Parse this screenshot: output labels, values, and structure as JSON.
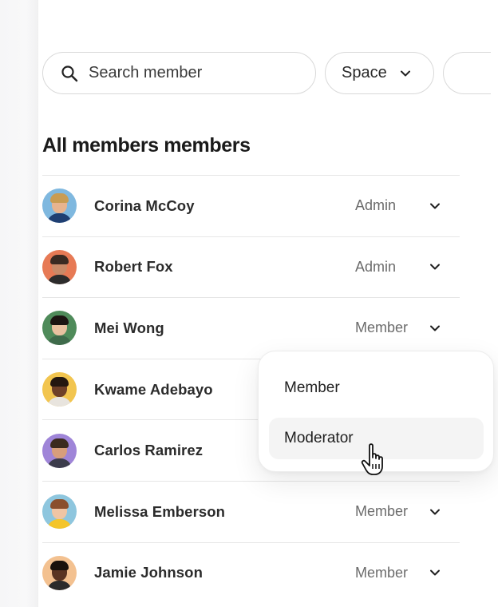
{
  "search": {
    "placeholder": "Search member"
  },
  "filters": {
    "space_label": "Space"
  },
  "title": "All members members",
  "members": [
    {
      "name": "Corina McCoy",
      "role": "Admin",
      "bg": "#7fb8df",
      "skin": "#e8b48f",
      "hair": "#c99c52",
      "shirt": "#1f3f72"
    },
    {
      "name": "Robert Fox",
      "role": "Admin",
      "bg": "#e77a55",
      "skin": "#c98a68",
      "hair": "#3a2a22",
      "shirt": "#2c2c2c"
    },
    {
      "name": "Mei Wong",
      "role": "Member",
      "bg": "#4f8b5a",
      "skin": "#e9c1a0",
      "hair": "#1c1512",
      "shirt": "#3f6b4b"
    },
    {
      "name": "Kwame Adebayo",
      "role": "",
      "bg": "#f2c54f",
      "skin": "#6e4028",
      "hair": "#231710",
      "shirt": "#e8e4de"
    },
    {
      "name": "Carlos Ramirez",
      "role": "",
      "bg": "#9f85d8",
      "skin": "#d79e7c",
      "hair": "#3b2a1f",
      "shirt": "#3c3c4c"
    },
    {
      "name": "Melissa Emberson",
      "role": "Member",
      "bg": "#8ec6de",
      "skin": "#f0c5a4",
      "hair": "#8a4f2c",
      "shirt": "#f4c52a"
    },
    {
      "name": "Jamie Johnson",
      "role": "Member",
      "bg": "#f3c190",
      "skin": "#5a3422",
      "hair": "#1a120c",
      "shirt": "#2b2b2b"
    }
  ],
  "dropdown": {
    "options": [
      "Member",
      "Moderator"
    ],
    "hovered": "Moderator"
  },
  "icons": {
    "search": "search-icon",
    "chevron": "chevron-down-icon",
    "cursor": "hand-pointer-icon"
  }
}
